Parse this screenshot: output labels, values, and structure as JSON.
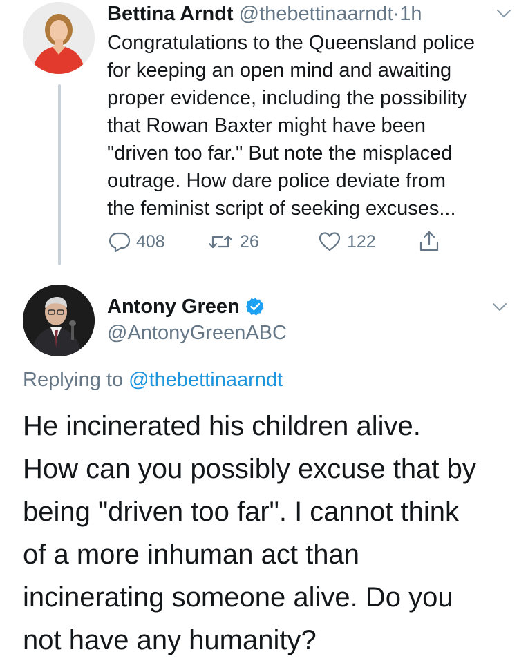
{
  "tweet1": {
    "author_name": "Bettina Arndt",
    "handle": "@thebettinaarndt",
    "separator": "·",
    "time": "1h",
    "text": "Congratulations to the Queensland police\nfor keeping an open mind and awaiting\nproper evidence, including the possibility\nthat Rowan Baxter might have been\n\"driven too far.\" But note the misplaced\noutrage. How dare police deviate from\nthe feminist script of seeking excuses...",
    "replies": "408",
    "retweets": "26",
    "likes": "122",
    "icons": {
      "more": "chevron-down-icon",
      "reply": "reply-bubble-icon",
      "retweet": "retweet-icon",
      "like": "heart-icon",
      "share": "share-icon"
    }
  },
  "tweet2": {
    "author_name": "Antony Green",
    "handle": "@AntonyGreenABC",
    "replying_prefix": "Replying to",
    "replying_to": "@thebettinaarndt",
    "text": "He incinerated his children alive.\nHow can you possibly excuse that by\nbeing \"driven too far\". I cannot think\nof a more inhuman act than\nincinerating someone alive. Do you\nnot have any humanity?",
    "icons": {
      "verified": "verified-badge-icon",
      "more": "chevron-down-icon"
    }
  },
  "colors": {
    "text": "#14171a",
    "secondary": "#657786",
    "link": "#1b95e0",
    "verified": "#1da1f2",
    "thread_line": "#c9d1d9"
  }
}
